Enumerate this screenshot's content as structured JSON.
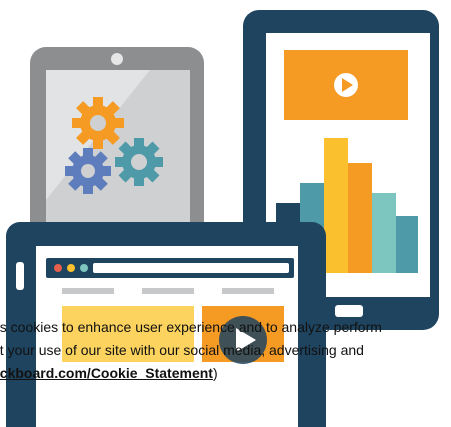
{
  "illustration": {
    "icons": [
      "gears-icon",
      "play-icon",
      "bar-chart-icon"
    ],
    "colors": {
      "navy": "#1f4460",
      "gray_tablet": "#8c8e90",
      "orange": "#f59a23",
      "yellow": "#fbc02d",
      "teal": "#4f9aa8",
      "light_teal": "#7dc6c0",
      "blue": "#5d7dbd"
    }
  },
  "cookie_banner": {
    "line1": "es cookies to enhance user experience and to analyze perform",
    "line2": "ut your use of our site with our social media, advertising and",
    "link_prefix": "",
    "link_text": "ackboard.com/Cookie_Statement",
    "link_suffix": ")"
  }
}
